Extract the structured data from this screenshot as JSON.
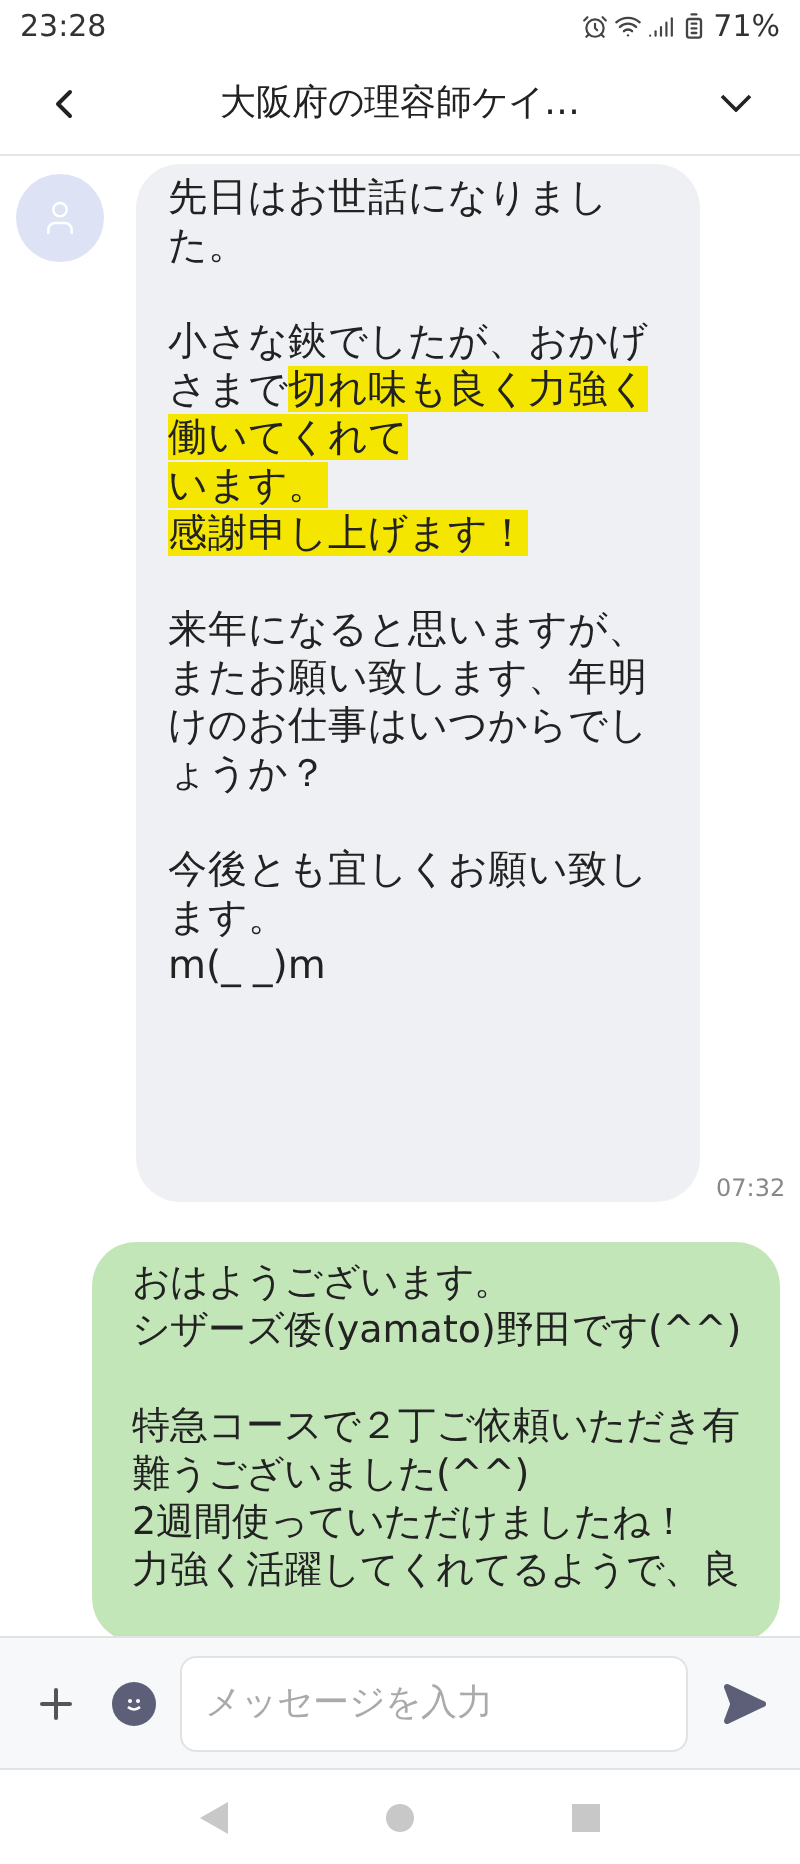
{
  "status_bar": {
    "time": "23:28",
    "battery": "71%"
  },
  "header": {
    "title": "大阪府の理容師ケイ…"
  },
  "messages": [
    {
      "kind": "incoming",
      "time": "07:32",
      "paragraphs": [
        [
          [
            {
              "text": "先日はお世話になりまし",
              "highlighted": false
            }
          ],
          [
            {
              "text": "た。",
              "highlighted": false
            }
          ]
        ],
        [
          [
            {
              "text": "小さな鋏でしたが、おかげ",
              "highlighted": false
            }
          ],
          [
            {
              "text": "さまで",
              "highlighted": false
            },
            {
              "text": "切れ味も良く力強く",
              "highlighted": true
            }
          ],
          [
            {
              "text": "働いてくれて",
              "highlighted": true
            }
          ],
          [
            {
              "text": "います。",
              "highlighted": true
            }
          ],
          [
            {
              "text": "感謝申し上げます！",
              "highlighted": true
            }
          ]
        ],
        [
          [
            {
              "text": "来年になると思いますが、",
              "highlighted": false
            }
          ],
          [
            {
              "text": "またお願い致します、年明",
              "highlighted": false
            }
          ],
          [
            {
              "text": "けのお仕事はいつからでし",
              "highlighted": false
            }
          ],
          [
            {
              "text": "ょうか？",
              "highlighted": false
            }
          ]
        ],
        [
          [
            {
              "text": "今後とも宜しくお願い致し",
              "highlighted": false
            }
          ],
          [
            {
              "text": "ます。",
              "highlighted": false
            }
          ],
          [
            {
              "text": "m(_ _)m",
              "highlighted": false
            }
          ]
        ]
      ]
    },
    {
      "kind": "outgoing",
      "paragraphs": [
        [
          [
            {
              "text": "おはようございます。",
              "highlighted": false
            }
          ],
          [
            {
              "text": "シザーズ倭(yamato)野田です(^^)",
              "highlighted": false
            }
          ]
        ],
        [
          [
            {
              "text": "特急コースで２丁ご依頼いただき有",
              "highlighted": false
            }
          ],
          [
            {
              "text": "難うございました(^^)",
              "highlighted": false
            }
          ],
          [
            {
              "text": "2週間使っていただけましたね！",
              "highlighted": false
            }
          ],
          [
            {
              "text": "力強く活躍してくれてるようで、良",
              "highlighted": false
            }
          ]
        ]
      ]
    }
  ],
  "composer": {
    "placeholder": "メッセージを入力"
  }
}
